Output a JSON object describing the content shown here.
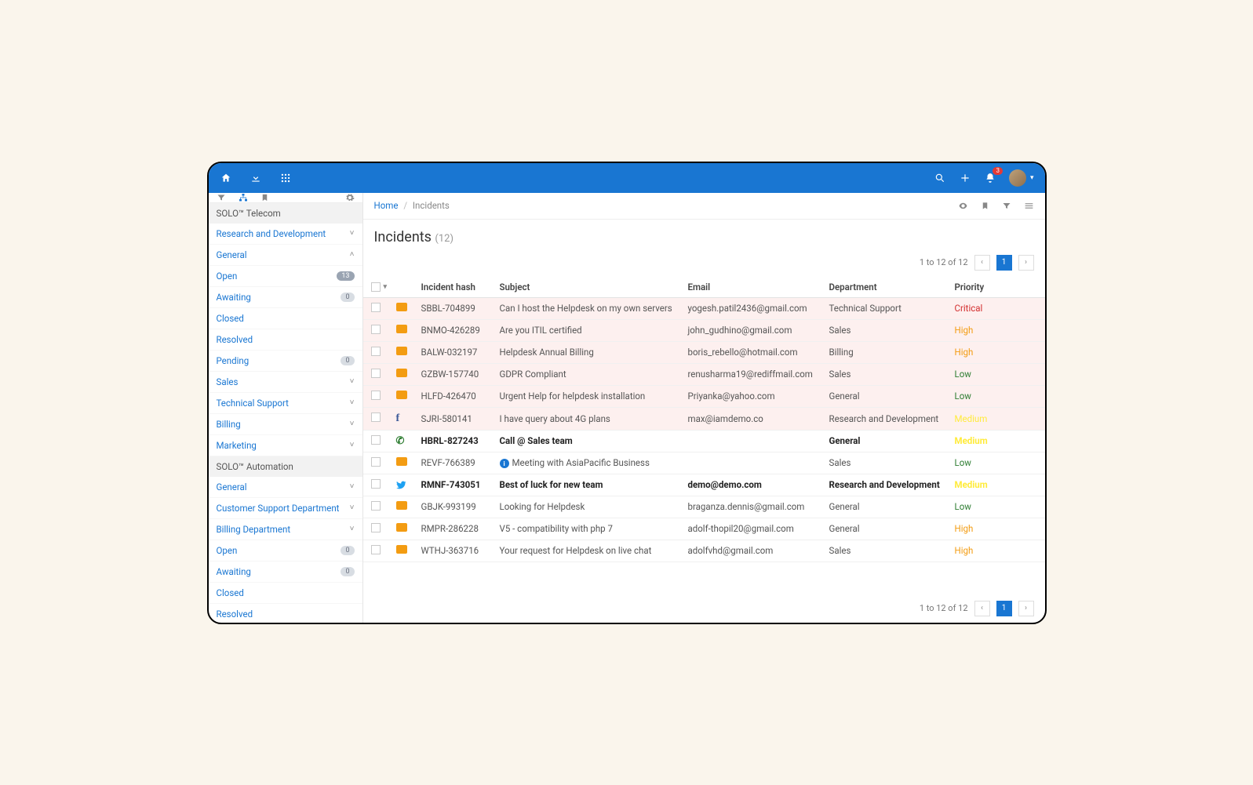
{
  "topbar": {
    "notification_count": "3"
  },
  "breadcrumb": {
    "home": "Home",
    "sep": "/",
    "current": "Incidents"
  },
  "title": {
    "text": "Incidents",
    "count": "(12)"
  },
  "pager": {
    "summary": "1 to 12 of 12",
    "page": "1"
  },
  "columns": {
    "hash": "Incident hash",
    "subject": "Subject",
    "email": "Email",
    "department": "Department",
    "priority": "Priority"
  },
  "sidebar": [
    {
      "type": "hdr",
      "label": "SOLO™ Telecom"
    },
    {
      "type": "item",
      "label": "Research and Development",
      "chev": "down"
    },
    {
      "type": "item",
      "label": "General",
      "chev": "up"
    },
    {
      "type": "sub",
      "label": "Open",
      "badge": "13",
      "badgeStyle": "fill"
    },
    {
      "type": "sub",
      "label": "Awaiting",
      "badge": "0"
    },
    {
      "type": "sub",
      "label": "Closed"
    },
    {
      "type": "sub",
      "label": "Resolved"
    },
    {
      "type": "sub",
      "label": "Pending",
      "badge": "0"
    },
    {
      "type": "item",
      "label": "Sales",
      "chev": "down"
    },
    {
      "type": "item",
      "label": "Technical Support",
      "chev": "down"
    },
    {
      "type": "item",
      "label": "Billing",
      "chev": "down"
    },
    {
      "type": "item",
      "label": "Marketing",
      "chev": "down"
    },
    {
      "type": "hdr",
      "label": "SOLO™ Automation"
    },
    {
      "type": "item",
      "label": "General",
      "chev": "down"
    },
    {
      "type": "item",
      "label": "Customer Support Department",
      "chev": "down"
    },
    {
      "type": "item",
      "label": "Billing Department",
      "chev": "down"
    },
    {
      "type": "sub",
      "label": "Open",
      "badge": "0"
    },
    {
      "type": "sub",
      "label": "Awaiting",
      "badge": "0"
    },
    {
      "type": "sub",
      "label": "Closed"
    },
    {
      "type": "sub",
      "label": "Resolved"
    }
  ],
  "rows": [
    {
      "src": "mail",
      "hash": "SBBL-704899",
      "subject": "Can I host the Helpdesk on my own servers",
      "email": "yogesh.patil2436@gmail.com",
      "dept": "Technical Support",
      "prio": "Critical",
      "prioClass": "critical",
      "pink": true
    },
    {
      "src": "mail",
      "hash": "BNMO-426289",
      "subject": "Are you ITIL certified",
      "email": "john_gudhino@gmail.com",
      "dept": "Sales",
      "prio": "High",
      "prioClass": "high",
      "pink": true
    },
    {
      "src": "mail",
      "hash": "BALW-032197",
      "subject": "Helpdesk Annual Billing",
      "email": "boris_rebello@hotmail.com",
      "dept": "Billing",
      "prio": "High",
      "prioClass": "high",
      "pink": true
    },
    {
      "src": "mail",
      "hash": "GZBW-157740",
      "subject": "GDPR Compliant",
      "email": "renusharma19@rediffmail.com",
      "dept": "Sales",
      "prio": "Low",
      "prioClass": "low",
      "pink": true
    },
    {
      "src": "mail",
      "hash": "HLFD-426470",
      "subject": "Urgent Help for helpdesk installation",
      "email": "Priyanka@yahoo.com",
      "dept": "General",
      "prio": "Low",
      "prioClass": "low",
      "pink": true
    },
    {
      "src": "fb",
      "hash": "SJRI-580141",
      "subject": "I have query about 4G plans",
      "email": "max@iamdemo.co",
      "dept": "Research and Development",
      "prio": "Medium",
      "prioClass": "medium",
      "pink": true
    },
    {
      "src": "phone",
      "hash": "HBRL-827243",
      "subject": "Call @ Sales team",
      "email": "",
      "dept": "General",
      "prio": "Medium",
      "prioClass": "medium",
      "bold": true
    },
    {
      "src": "mail",
      "hash": "REVF-766389",
      "subject": "Meeting with AsiaPacific Business",
      "email": "",
      "dept": "Sales",
      "prio": "Low",
      "prioClass": "low",
      "info": true
    },
    {
      "src": "tw",
      "hash": "RMNF-743051",
      "subject": "Best of luck for new team",
      "email": "demo@demo.com",
      "dept": "Research and Development",
      "prio": "Medium",
      "prioClass": "medium",
      "bold": true
    },
    {
      "src": "mail",
      "hash": "GBJK-993199",
      "subject": "Looking for Helpdesk",
      "email": "braganza.dennis@gmail.com",
      "dept": "General",
      "prio": "Low",
      "prioClass": "low"
    },
    {
      "src": "mail",
      "hash": "RMPR-286228",
      "subject": "V5 - compatibility with php 7",
      "email": "adolf-thopil20@gmail.com",
      "dept": "General",
      "prio": "High",
      "prioClass": "high"
    },
    {
      "src": "mail",
      "hash": "WTHJ-363716",
      "subject": "Your request for Helpdesk on live chat",
      "email": "adolfvhd@gmail.com",
      "dept": "Sales",
      "prio": "High",
      "prioClass": "high"
    }
  ]
}
